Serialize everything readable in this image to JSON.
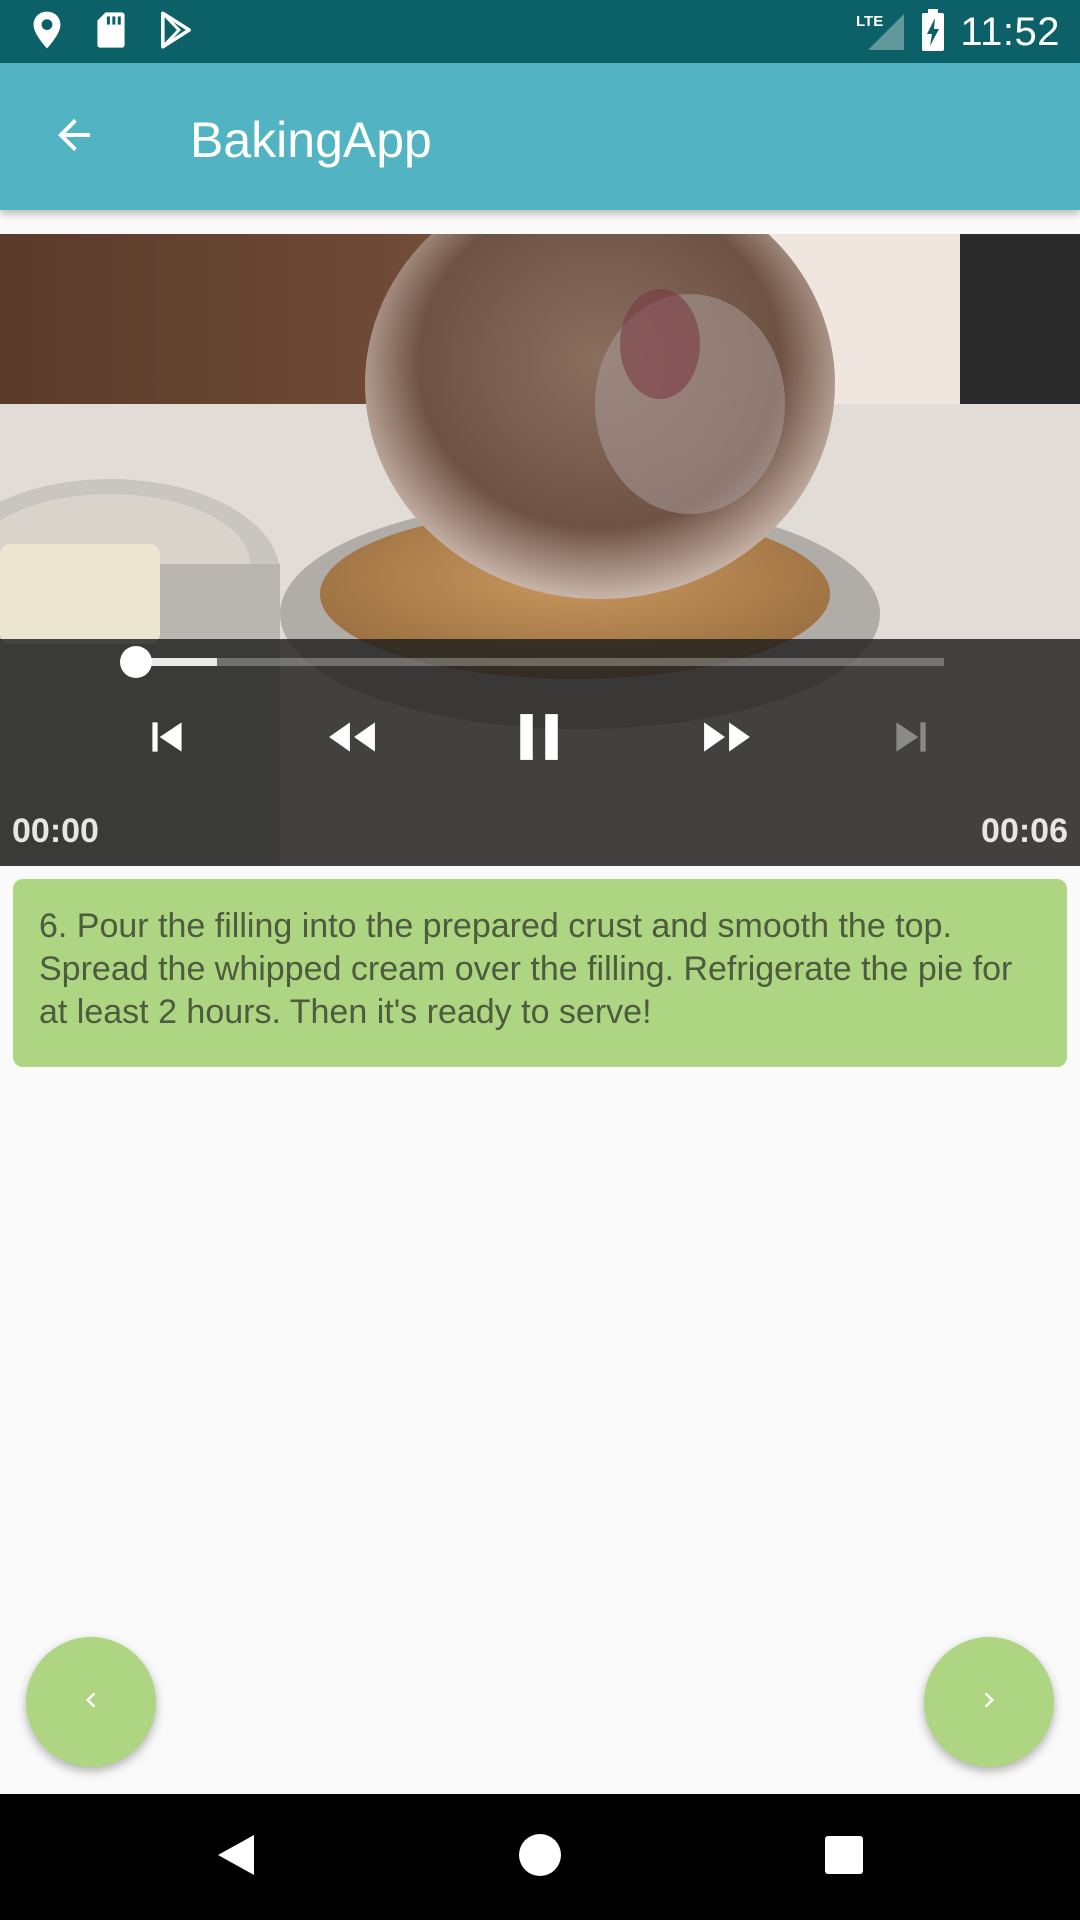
{
  "status_bar": {
    "time": "11:52",
    "network": "LTE",
    "icons": [
      "location-icon",
      "sd-card-icon",
      "play-store-icon",
      "signal-icon",
      "battery-charging-icon"
    ]
  },
  "app_bar": {
    "title": "BakingApp",
    "back_icon": "arrow-back-icon"
  },
  "video_player": {
    "position": "00:00",
    "duration": "00:06",
    "progress_fraction": 0.0,
    "buffered_fraction": 0.1,
    "controls": [
      "skip-previous-icon",
      "rewind-icon",
      "pause-icon",
      "fast-forward-icon",
      "skip-next-icon"
    ],
    "next_disabled": true
  },
  "step": {
    "description": "6. Pour the filling into the prepared crust and smooth the top. Spread the whipped cream over the filling. Refrigerate the pie for at least 2 hours. Then it's ready to serve!"
  },
  "navigation": {
    "prev_icon": "chevron-left-icon",
    "next_icon": "chevron-right-icon"
  },
  "colors": {
    "status_bar": "#0c6168",
    "app_bar": "#52b4c2",
    "accent_green": "#aed581"
  }
}
